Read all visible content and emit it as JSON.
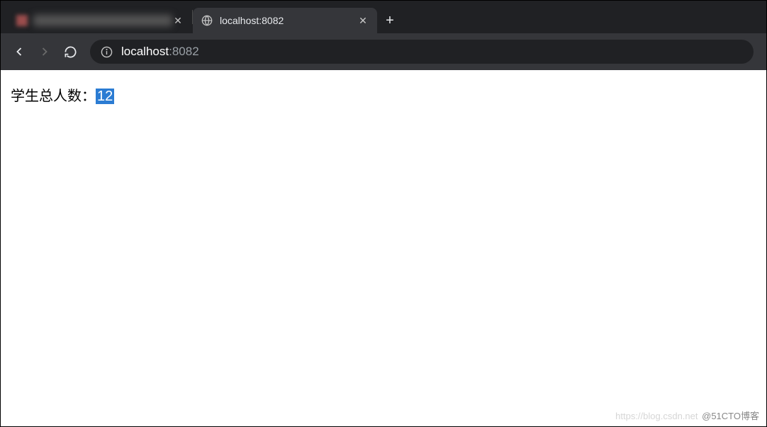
{
  "tabs": {
    "active_title": "localhost:8082",
    "new_tab_label": "+"
  },
  "toolbar": {
    "back_label": "Back",
    "forward_label": "Forward",
    "reload_label": "Reload"
  },
  "address": {
    "info_label": "Site information",
    "host": "localhost",
    "port_display": ":8082"
  },
  "page": {
    "label": "学生总人数：",
    "value": "12"
  },
  "watermark": {
    "faint": "https://blog.csdn.net",
    "text": "@51CTO博客"
  }
}
